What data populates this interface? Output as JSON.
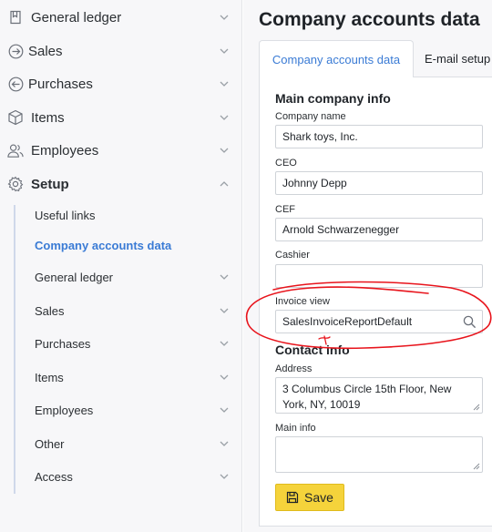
{
  "sidebar": {
    "items": [
      {
        "label": "General ledger",
        "icon": "book-icon"
      },
      {
        "label": "Sales",
        "icon": "arrow-right-circle-icon"
      },
      {
        "label": "Purchases",
        "icon": "arrow-left-circle-icon"
      },
      {
        "label": "Items",
        "icon": "box-icon"
      },
      {
        "label": "Employees",
        "icon": "users-icon"
      },
      {
        "label": "Setup",
        "icon": "gear-icon"
      }
    ],
    "setup_children": [
      {
        "label": "Useful links"
      },
      {
        "label": "Company accounts data"
      },
      {
        "label": "General ledger"
      },
      {
        "label": "Sales"
      },
      {
        "label": "Purchases"
      },
      {
        "label": "Items"
      },
      {
        "label": "Employees"
      },
      {
        "label": "Other"
      },
      {
        "label": "Access"
      }
    ]
  },
  "main": {
    "title": "Company accounts data",
    "tabs": [
      {
        "label": "Company accounts data"
      },
      {
        "label": "E-mail setup"
      }
    ],
    "form": {
      "main_section_title": "Main company info",
      "company_name_label": "Company name",
      "company_name_value": "Shark toys, Inc.",
      "ceo_label": "CEO",
      "ceo_value": "Johnny Depp",
      "cef_label": "CEF",
      "cef_value": "Arnold Schwarzenegger",
      "cashier_label": "Cashier",
      "cashier_value": "",
      "invoice_view_label": "Invoice view",
      "invoice_view_value": "SalesInvoiceReportDefault",
      "contact_section_title": "Contact info",
      "address_label": "Address",
      "address_value": "3 Columbus Circle 15th Floor, New York, NY, 10019",
      "main_info_label": "Main info",
      "main_info_value": "",
      "save_label": "Save"
    }
  },
  "colors": {
    "accent": "#3a7bd5",
    "save_button": "#f5d33b",
    "annotation": "#e8141c"
  }
}
